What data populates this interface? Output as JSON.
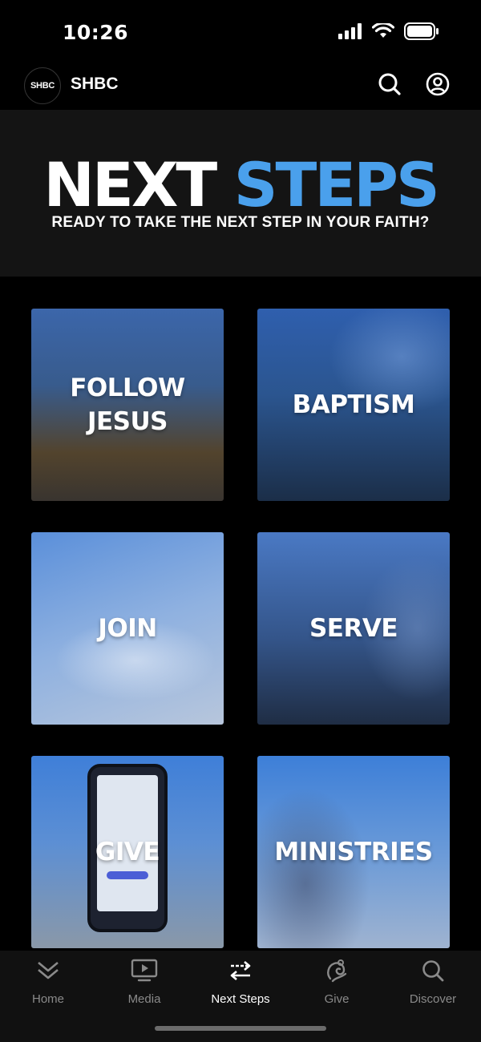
{
  "status_bar": {
    "time": "10:26"
  },
  "header": {
    "logo_text": "SHBC",
    "title": "SHBC"
  },
  "hero": {
    "title_word1": "NEXT",
    "title_word2": "STEPS",
    "subtitle": "READY TO TAKE THE NEXT STEP IN YOUR FAITH?",
    "accent_color": "#4aa0ec"
  },
  "tiles": [
    {
      "label": "FOLLOW\nJESUS"
    },
    {
      "label": "BAPTISM"
    },
    {
      "label": "JOIN"
    },
    {
      "label": "SERVE"
    },
    {
      "label": "GIVE"
    },
    {
      "label": "MINISTRIES"
    }
  ],
  "tabbar": {
    "tabs": [
      {
        "label": "Home",
        "icon": "double-chevron-down-icon"
      },
      {
        "label": "Media",
        "icon": "tv-play-icon"
      },
      {
        "label": "Next Steps",
        "icon": "swap-arrows-icon",
        "active": true
      },
      {
        "label": "Give",
        "icon": "give-hand-icon"
      },
      {
        "label": "Discover",
        "icon": "search-icon"
      }
    ]
  }
}
